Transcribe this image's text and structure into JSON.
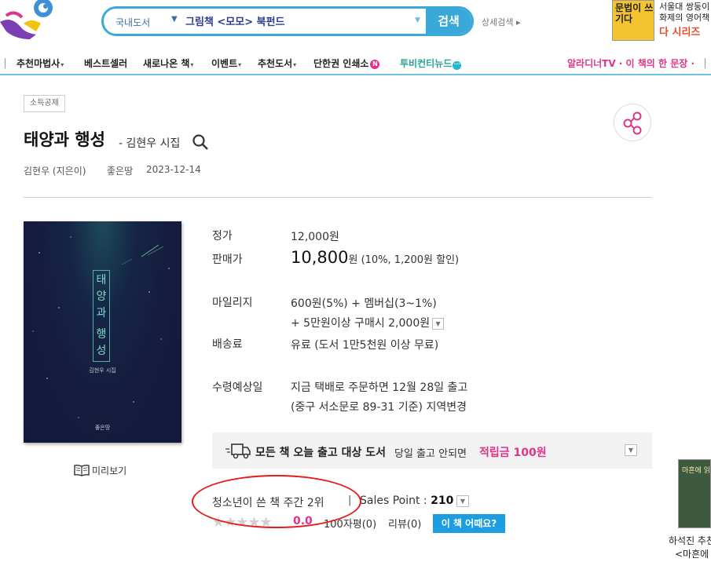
{
  "header": {
    "search_category": "국내도서",
    "search_query": "그림책 <모모> 북펀드",
    "search_button": "검색",
    "advanced_search": "상세검색 ▸",
    "ad_book_title": "문법이 쓰기다",
    "ad_line1": "서울대 쌍둥이",
    "ad_line2": "화제의 영어책",
    "ad_line3": "다 시리즈"
  },
  "nav": {
    "items": [
      {
        "label": "추천마법사",
        "caret": "▾"
      },
      {
        "label": "베스트셀러",
        "caret": ""
      },
      {
        "label": "새로나온 책",
        "caret": "▾"
      },
      {
        "label": "이벤트",
        "caret": "▾"
      },
      {
        "label": "추천도서",
        "caret": "▾"
      },
      {
        "label": "단한권 인쇄소",
        "badge": "N"
      },
      {
        "label": "투비컨티뉴드",
        "badge": "···"
      }
    ],
    "right_links": "알라디너TV · 이 책의 한 문장 ·"
  },
  "book": {
    "tag": "소득공제",
    "title": "태양과 행성",
    "subtitle": "- 김현우 시집",
    "author": "김현우 (지은이)",
    "publisher": "좋은땅",
    "date": "2023-12-14",
    "cover_title_chars": [
      "태",
      "양",
      "과",
      "행",
      "성"
    ],
    "cover_author": "김현우 시집",
    "cover_publisher": "좋은땅",
    "preview_label": "미리보기"
  },
  "pricing": {
    "list_price_label": "정가",
    "list_price": "12,000원",
    "sale_price_label": "판매가",
    "sale_price": "10,800",
    "sale_price_suffix": "원 (10%, 1,200원 할인)",
    "mileage_label": "마일리지",
    "mileage_line1": "600원(5%) + 멤버십(3~1%)",
    "mileage_line2": "+ 5만원이상 구매시 2,000원",
    "shipping_label": "배송료",
    "shipping": "유료 (도서 1만5천원 이상 무료)",
    "delivery_label": "수령예상일",
    "delivery_line1": "지금 택배로 주문하면 12월 28일 출고",
    "delivery_line2": "(중구 서소문로 89-31 기준) 지역변경"
  },
  "notice": {
    "main": "모든 책 오늘 출고 대상 도서",
    "sub": "당일 출고 안되면",
    "highlight": "적립금 100원"
  },
  "stats": {
    "rank": "청소년이 쓴 책 주간 2위",
    "separator": "|",
    "sales_label": "Sales Point :",
    "sales_value": "210",
    "stars": "★★★★★",
    "score": "0.0",
    "review_count": "100자평(0)",
    "review_count2": "리뷰(0)",
    "how_button": "이 책 어때요?"
  },
  "side_ad": {
    "book_text": "마흔에 읽는 쇼펜하우어",
    "line1": "하석진 추천",
    "line2": "<마흔에 읽"
  },
  "colors": {
    "accent": "#3aa8d8",
    "pink": "#e0348a",
    "annotation_red": "#e31b1b"
  }
}
